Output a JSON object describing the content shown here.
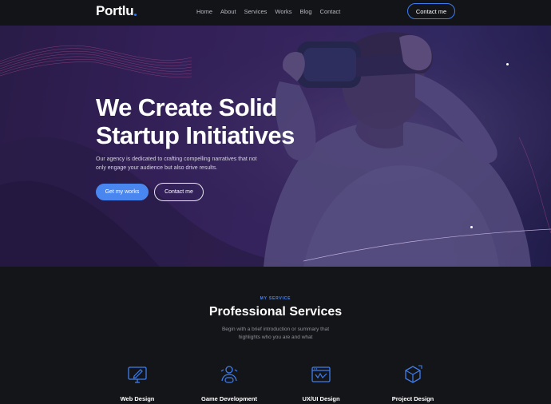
{
  "brand": {
    "logo_text": "Portlu",
    "accent": "#2f7bf5"
  },
  "nav": {
    "items": [
      "Home",
      "About",
      "Services",
      "Works",
      "Blog",
      "Contact"
    ],
    "cta_label": "Contact me"
  },
  "hero": {
    "title_line1": "We Create Solid",
    "title_line2": "Startup Initiatives",
    "description": "Our agency is dedicated to crafting compelling narratives that not only engage your audience but also drive results.",
    "primary_button": "Get my works",
    "secondary_button": "Contact me"
  },
  "services": {
    "eyebrow": "MY SERVICE",
    "title": "Professional Services",
    "description": "Begin with a brief introduction or summary that highlights who you are and what",
    "items": [
      {
        "label": "Web Design",
        "icon": "monitor-pen-icon"
      },
      {
        "label": "Game Development",
        "icon": "gamepad-person-icon"
      },
      {
        "label": "UX/UI Design",
        "icon": "design-browser-icon"
      },
      {
        "label": "Project Design",
        "icon": "cube-plan-icon"
      }
    ]
  }
}
